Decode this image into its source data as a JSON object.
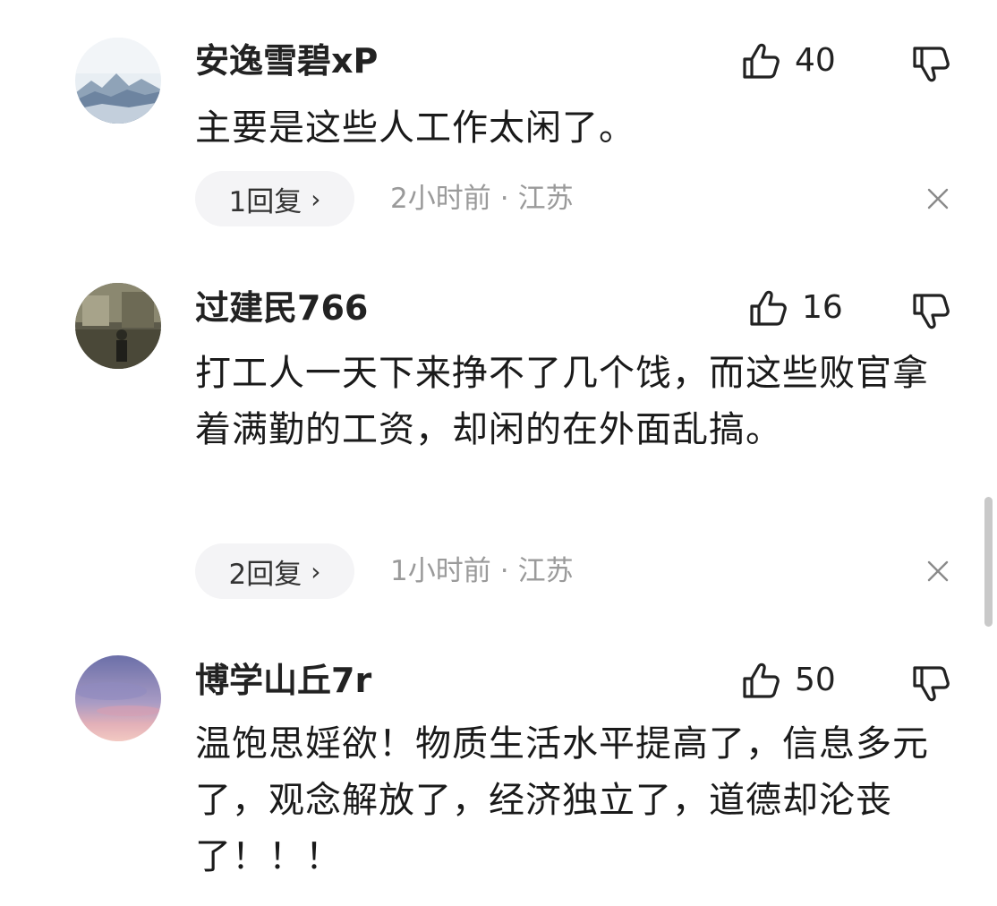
{
  "comments": [
    {
      "username": "安逸雪碧xP",
      "likes": "40",
      "body": "主要是这些人工作太闲了。",
      "replies": "1回复",
      "time": "2小时前",
      "dot": "·",
      "location": "江苏",
      "avatar": "mountain-landscape"
    },
    {
      "username": "过建民766",
      "likes": "16",
      "body": "打工人一天下来挣不了几个饯，而这些败官拿着满勤的工资，却闲的在外面乱搞。",
      "replies": "2回复",
      "time": "1小时前",
      "dot": "·",
      "location": "江苏",
      "avatar": "person-photo"
    },
    {
      "username": "博学山丘7r",
      "likes": "50",
      "body": "温饱思婬欲！物质生活水平提高了，信息多元了，观念解放了，经济独立了，道德却沦丧了！！！",
      "avatar": "sunset-sky"
    }
  ],
  "reply_chevron": "›",
  "icons": {
    "like": "thumbs-up-icon",
    "dislike": "thumbs-down-icon",
    "close": "close-icon"
  }
}
